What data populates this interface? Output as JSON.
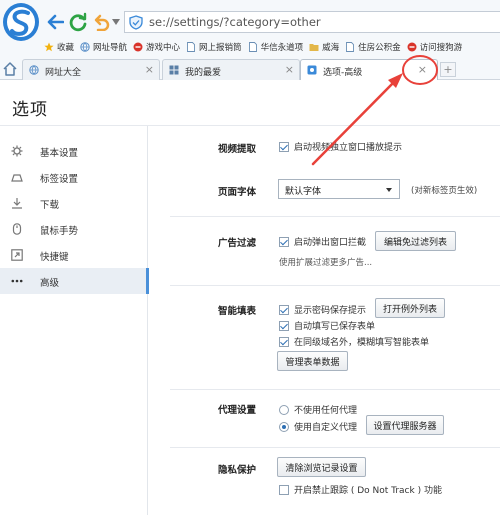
{
  "browser": {
    "url": "se://settings/?category=other",
    "bookmarks": [
      {
        "label": "收藏",
        "icon": "star-icon",
        "color": "#f2b20f"
      },
      {
        "label": "网址导航",
        "icon": "globe-icon",
        "color": "#5a8fc8"
      },
      {
        "label": "游戏中心",
        "icon": "game-icon",
        "color": "#d9342b"
      },
      {
        "label": "网上报销筒",
        "icon": "page-icon",
        "color": "#6b8fb5"
      },
      {
        "label": "华信永道项",
        "icon": "page-icon",
        "color": "#6b8fb5"
      },
      {
        "label": "威海",
        "icon": "folder-icon",
        "color": "#e3b74a"
      },
      {
        "label": "住房公积金",
        "icon": "page-icon",
        "color": "#6b8fb5"
      },
      {
        "label": "访问搜狗游",
        "icon": "game-icon",
        "color": "#d9342b"
      }
    ],
    "tabs": [
      {
        "label": "网址大全",
        "icon": "globe-icon",
        "close": "×"
      },
      {
        "label": "我的最爱",
        "icon": "grid-icon",
        "close": "×"
      },
      {
        "label": "选项-高级",
        "icon": "settings-page-icon",
        "close": "×"
      }
    ],
    "new_tab": "+",
    "accent_color": "#e8413a"
  },
  "page": {
    "title": "选项"
  },
  "sidebar": {
    "items": [
      {
        "label": "基本设置",
        "icon": "gear-icon"
      },
      {
        "label": "标签设置",
        "icon": "tab-icon"
      },
      {
        "label": "下载",
        "icon": "download-icon"
      },
      {
        "label": "鼠标手势",
        "icon": "mouse-icon"
      },
      {
        "label": "快捷键",
        "icon": "shortcut-icon"
      },
      {
        "label": "高级",
        "icon": "more-icon",
        "active": true
      }
    ]
  },
  "sections": {
    "video": {
      "label": "视频提取",
      "option": "启动视频独立窗口播放提示",
      "checked": true
    },
    "font": {
      "label": "页面字体",
      "select_value": "默认字体",
      "hint": "(对新标签页生效)"
    },
    "ads": {
      "label": "广告过滤",
      "option": "启动弹出窗口拦截",
      "checked": true,
      "button": "编辑免过滤列表",
      "note": "使用扩展过滤更多广告..."
    },
    "autofill": {
      "label": "智能填表",
      "options": [
        {
          "text": "显示密码保存提示",
          "checked": true
        },
        {
          "text": "自动填写已保存表单",
          "checked": true
        },
        {
          "text": "在同级域名外，模糊填写智能表单",
          "checked": true
        }
      ],
      "exceptions_button": "打开例外列表",
      "manage_button": "管理表单数据"
    },
    "proxy": {
      "label": "代理设置",
      "options": [
        {
          "text": "不使用任何代理",
          "selected": false
        },
        {
          "text": "使用自定义代理",
          "selected": true
        }
      ],
      "button": "设置代理服务器"
    },
    "privacy": {
      "label": "隐私保护",
      "button": "清除浏览记录设置",
      "option": "开启禁止跟踪 ( Do Not Track ) 功能",
      "checked": false
    }
  }
}
